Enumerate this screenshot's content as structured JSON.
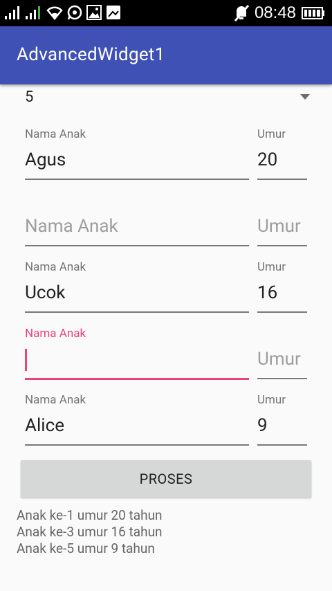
{
  "status_bar": {
    "time": "08:48",
    "icons": [
      "signal-icon",
      "signal-icon",
      "wifi-icon",
      "whatsapp-icon",
      "image-icon",
      "gallery-icon",
      "mute-icon",
      "battery-icon"
    ]
  },
  "app_bar": {
    "title": "AdvancedWidget1"
  },
  "spinner": {
    "selected": "5"
  },
  "rows": [
    {
      "name_label": "Nama Anak",
      "name_value": "Agus",
      "age_label": "Umur",
      "age_value": "20"
    },
    {
      "name_hint": "Nama Anak",
      "age_hint": "Umur"
    },
    {
      "name_label": "Nama Anak",
      "name_value": "Ucok",
      "age_label": "Umur",
      "age_value": "16"
    },
    {
      "name_label": "Nama Anak",
      "name_value": "",
      "age_hint": "Umur"
    },
    {
      "name_label": "Nama Anak",
      "name_value": "Alice",
      "age_label": "Umur",
      "age_value": "9"
    }
  ],
  "button": {
    "label": "PROSES"
  },
  "results": [
    "Anak ke-1 umur 20 tahun",
    "Anak ke-3 umur 16 tahun",
    "Anak ke-5 umur 9 tahun"
  ],
  "colors": {
    "primary": "#3f51b5",
    "accent": "#e8437d"
  }
}
